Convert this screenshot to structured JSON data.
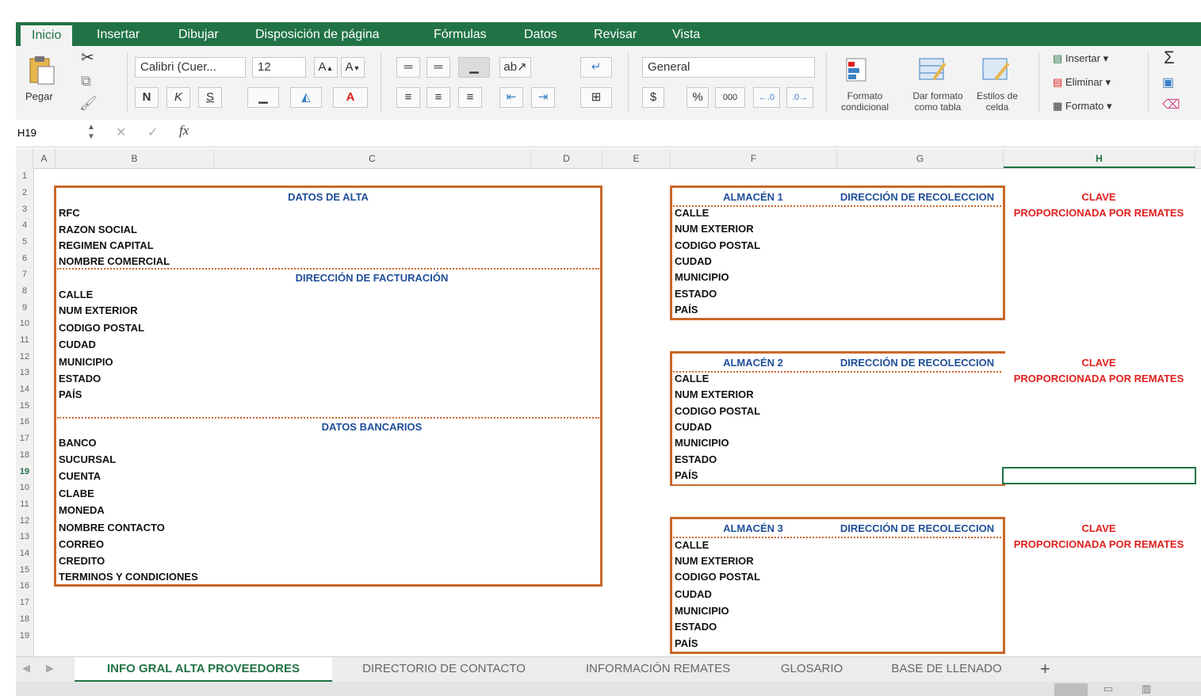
{
  "ribbon_tabs": [
    "Inicio",
    "Insertar",
    "Dibujar",
    "Disposición de página",
    "Fórmulas",
    "Datos",
    "Revisar",
    "Vista"
  ],
  "toolbar": {
    "paste_label": "Pegar",
    "font_name": "Calibri (Cuer...",
    "font_size": "12",
    "grow_font": "A",
    "shrink_font": "A",
    "bold": "N",
    "italic": "K",
    "underline": "S",
    "font_color_letter": "A",
    "number_format": "General",
    "currency": "$",
    "percent": "%",
    "thousands": "000",
    "conditional_format": "Formato condicional",
    "format_as_table": "Dar formato como tabla",
    "cell_styles": "Estilos de celda",
    "insert": "Insertar",
    "delete": "Eliminar",
    "format": "Formato",
    "sum": "Σ"
  },
  "formula_bar": {
    "name_box": "H19",
    "cancel": "✕",
    "enter": "✓",
    "fx": "fx"
  },
  "columns": [
    "A",
    "B",
    "C",
    "D",
    "E",
    "F",
    "G",
    "H"
  ],
  "rows": [
    "1",
    "2",
    "3",
    "4",
    "5",
    "6",
    "7",
    "8",
    "9",
    "10",
    "11",
    "12",
    "13",
    "14",
    "15",
    "16",
    "17",
    "18",
    "19",
    "10",
    "11",
    "12",
    "13",
    "14",
    "15",
    "16",
    "17",
    "18",
    "19"
  ],
  "alta": {
    "header": "DATOS DE ALTA",
    "general_fields": [
      "RFC",
      "RAZON SOCIAL",
      "REGIMEN CAPITAL",
      "NOMBRE COMERCIAL"
    ],
    "billing_header": "DIRECCIÓN DE FACTURACIÓN",
    "billing_fields": [
      "CALLE",
      "NUM EXTERIOR",
      "CODIGO POSTAL",
      "CUDAD",
      "MUNICIPIO",
      "ESTADO",
      "PAÍS"
    ],
    "bank_header": "DATOS BANCARIOS",
    "bank_fields": [
      "BANCO",
      "SUCURSAL",
      "CUENTA",
      "CLABE",
      "MONEDA",
      "NOMBRE CONTACTO",
      "CORREO",
      "CREDITO",
      "TERMINOS Y CONDICIONES"
    ]
  },
  "warehouses": [
    {
      "name": "ALMACÉN 1",
      "address_header": "DIRECCIÓN DE RECOLECCION",
      "fields": [
        "CALLE",
        "NUM EXTERIOR",
        "CODIGO POSTAL",
        "CUDAD",
        "MUNICIPIO",
        "ESTADO",
        "PAÍS"
      ],
      "key_title": "CLAVE",
      "key_note": "PROPORCIONADA POR REMATES"
    },
    {
      "name": "ALMACÉN 2",
      "address_header": "DIRECCIÓN DE RECOLECCION",
      "fields": [
        "CALLE",
        "NUM EXTERIOR",
        "CODIGO POSTAL",
        "CUDAD",
        "MUNICIPIO",
        "ESTADO",
        "PAÍS"
      ],
      "key_title": "CLAVE",
      "key_note": "PROPORCIONADA POR REMATES"
    },
    {
      "name": "ALMACÉN 3",
      "address_header": "DIRECCIÓN DE RECOLECCION",
      "fields": [
        "CALLE",
        "NUM EXTERIOR",
        "CODIGO POSTAL",
        "CUDAD",
        "MUNICIPIO",
        "ESTADO",
        "PAÍS"
      ],
      "key_title": "CLAVE",
      "key_note": "PROPORCIONADA POR REMATES"
    }
  ],
  "sheet_tabs": [
    "INFO GRAL ALTA PROVEEDORES",
    "DIRECTORIO DE CONTACTO",
    "INFORMACIÓN REMATES",
    "GLOSARIO",
    "BASE DE LLENADO"
  ],
  "add_sheet": "+",
  "colors": {
    "excel_green": "#217346",
    "box_orange": "#c9682a",
    "header_blue": "#1f4e9a",
    "key_red": "#e0201e"
  }
}
